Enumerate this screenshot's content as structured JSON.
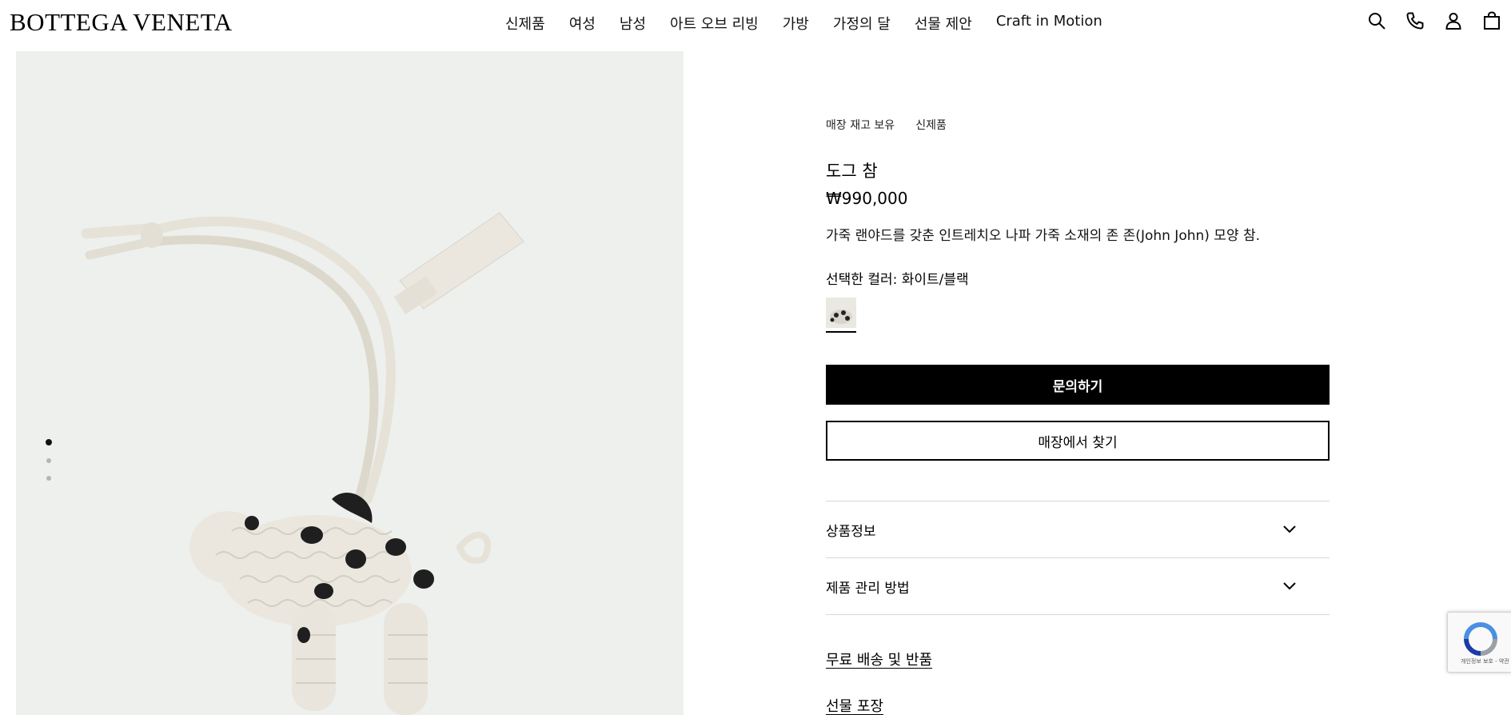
{
  "header": {
    "logo": "BOTTEGA VENETA",
    "nav": [
      "신제품",
      "여성",
      "남성",
      "아트 오브 리빙",
      "가방",
      "가정의 달",
      "선물 제안",
      "Craft in Motion"
    ],
    "icons": [
      "search-icon",
      "phone-icon",
      "account-icon",
      "bag-icon"
    ]
  },
  "gallery": {
    "slides": 3,
    "active_slide": 1,
    "icons": [
      "dot-active",
      "dot",
      "dot"
    ]
  },
  "product": {
    "badges": [
      "매장 재고 보유",
      "신제품"
    ],
    "title": "도그 참",
    "price": "₩990,000",
    "description": "가죽 랜야드를 갖춘 인트레치오 나파 가죽 소재의 존 존(John John) 모양 참.",
    "color_label": "선택한 컬러: 화이트/블랙",
    "cta_primary": "문의하기",
    "cta_secondary": "매장에서 찾기",
    "accordion": [
      "상품정보",
      "제품 관리 방법"
    ],
    "links": [
      "무료 배송 및 반품",
      "선물 포장"
    ]
  },
  "recaptcha": {
    "text": "개인정보 보호 - 약관"
  },
  "colors": {
    "image_bg": "#eef0ee",
    "leather_white": "#ebe7de",
    "leather_black": "#1f1f1f",
    "primary_button": "#000000"
  }
}
